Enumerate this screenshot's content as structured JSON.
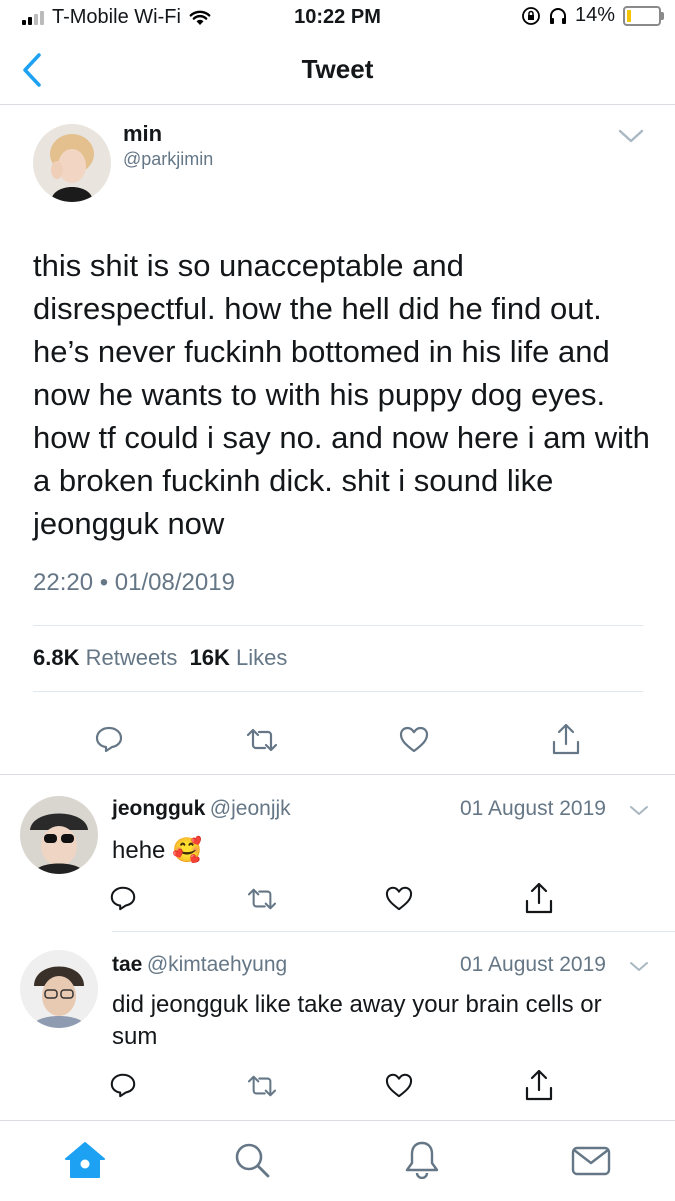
{
  "status_bar": {
    "carrier": "T-Mobile Wi-Fi",
    "time": "10:22 PM",
    "battery": "14%",
    "battery_level": 0.14
  },
  "nav": {
    "title": "Tweet"
  },
  "tweet": {
    "name": "min",
    "handle": "@parkjimin",
    "text": "this shit is so unacceptable and disrespectful. how the hell did he find out. he’s never fuckinh bottomed in his life and now he wants to with his puppy dog eyes. how tf could i say no. and now here i am with a broken fuckinh dick. shit i sound like jeongguk now",
    "timestamp": "22:20 • 01/08/2019",
    "retweets_count": "6.8K",
    "retweets_label": "Retweets",
    "likes_count": "16K",
    "likes_label": "Likes"
  },
  "replies": [
    {
      "name": "jeongguk",
      "handle": "@jeonjjk",
      "date": "01 August 2019",
      "text": "hehe",
      "emoji": "🥰"
    },
    {
      "name": "tae",
      "handle": "@kimtaehyung",
      "date": "01 August 2019",
      "text": "did jeongguk like take away your brain cells or sum"
    }
  ],
  "tab_bar": [
    "home-icon",
    "search-icon",
    "notifications-icon",
    "messages-icon"
  ],
  "colors": {
    "accent": "#1da1f2",
    "secondary_text": "#657786",
    "icon_gray": "#657786"
  }
}
